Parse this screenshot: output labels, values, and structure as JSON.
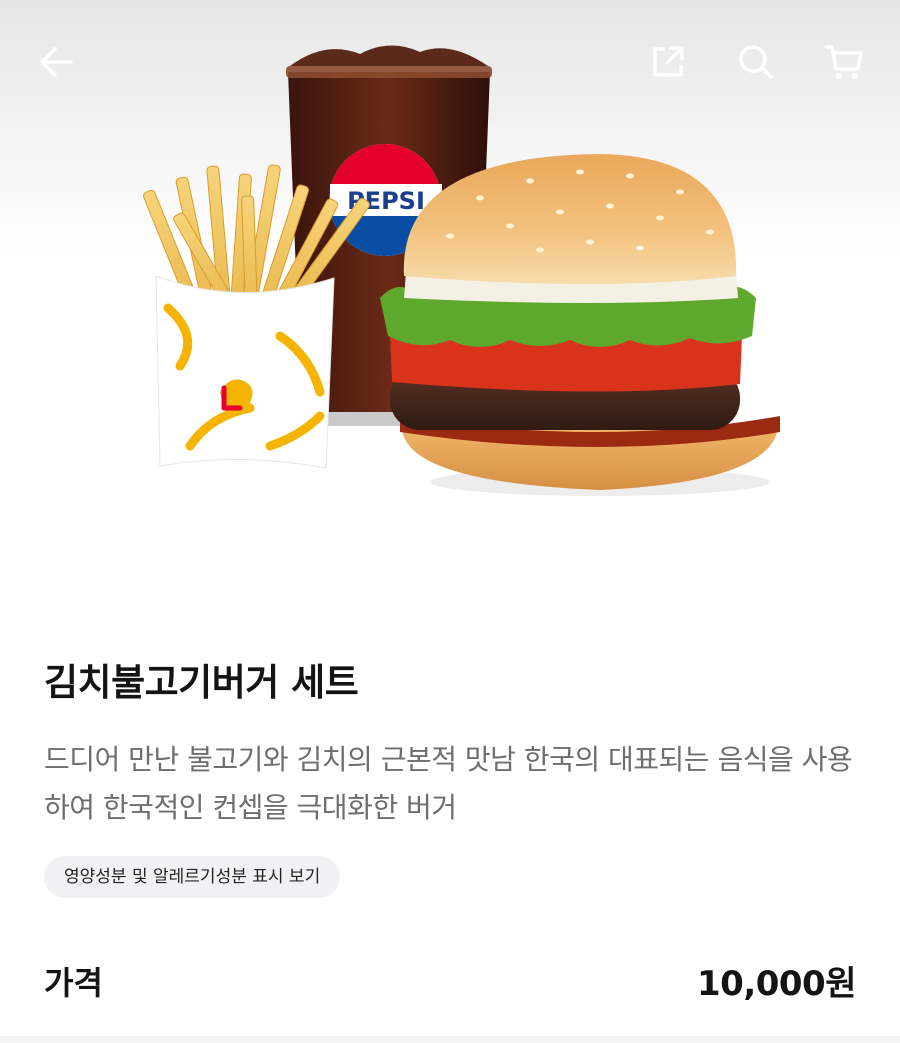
{
  "header": {
    "icons": {
      "back": "arrow-left-icon",
      "share": "share-icon",
      "search": "search-icon",
      "cart": "cart-icon"
    }
  },
  "product": {
    "name": "김치불고기버거 세트",
    "description": "드디어 만난 불고기와 김치의 근본적 맛남 한국의 대표되는 음식을 사용하여 한국적인 컨셉을 극대화한 버거",
    "nutrition_button": "영양성분 및 알레르기성분 표시 보기",
    "price_label": "가격",
    "price": "10,000원"
  },
  "colors": {
    "accent": "#e4002b",
    "text_primary": "#141414",
    "text_secondary": "#6e6e6e",
    "chip_bg": "#f1f1f3"
  }
}
